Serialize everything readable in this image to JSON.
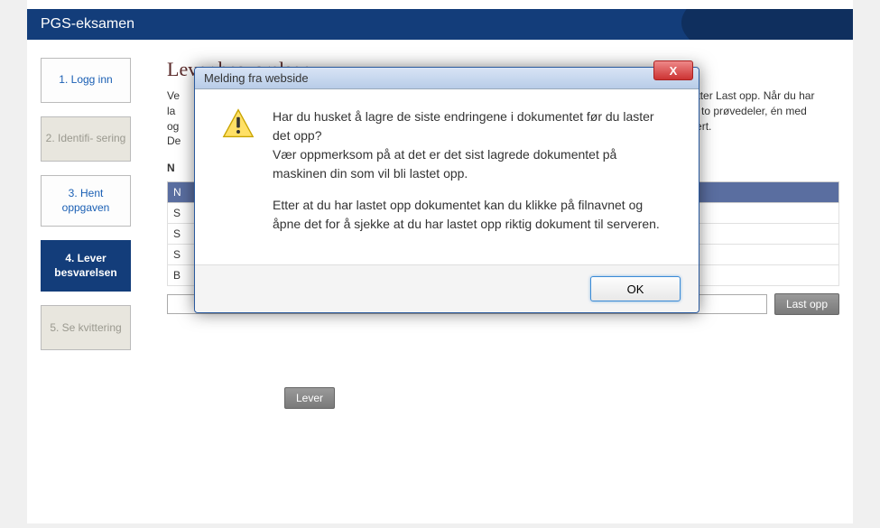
{
  "header": {
    "title": "PGS-eksamen"
  },
  "sidebar": {
    "steps": [
      {
        "label": "1. Logg inn"
      },
      {
        "label": "2. Identifi-\nsering"
      },
      {
        "label": "3. Hent oppgaven"
      },
      {
        "label": "4. Lever besvarelsen"
      },
      {
        "label": "5. Se kvittering"
      }
    ]
  },
  "main": {
    "heading": "Lever besvarelsen",
    "intro_prefix": "Ve",
    "intro_suffix_1": "etter Last opp. Når du har",
    "intro_line2_prefix": "la",
    "intro_line2_suffix": "av to prøvedeler, én med",
    "intro_line3_prefix": "og",
    "intro_line3_suffix": "vert.",
    "intro_line4_prefix": "De",
    "section_label": "N",
    "table_header": "N",
    "rows": [
      "S",
      "S",
      "S",
      "B"
    ],
    "upload_btn": "Last opp",
    "lever_btn": "Lever"
  },
  "dialog": {
    "title": "Melding fra webside",
    "close_label": "X",
    "para1": "Har du husket å lagre de siste endringene i dokumentet før du laster det opp?",
    "para2": "Vær oppmerksom på at det er det sist lagrede dokumentet på maskinen din som vil bli lastet opp.",
    "para3": "Etter at du har lastet opp dokumentet kan du klikke på filnavnet og åpne det for å sjekke at du har lastet opp riktig dokument til serveren.",
    "ok_label": "OK"
  }
}
